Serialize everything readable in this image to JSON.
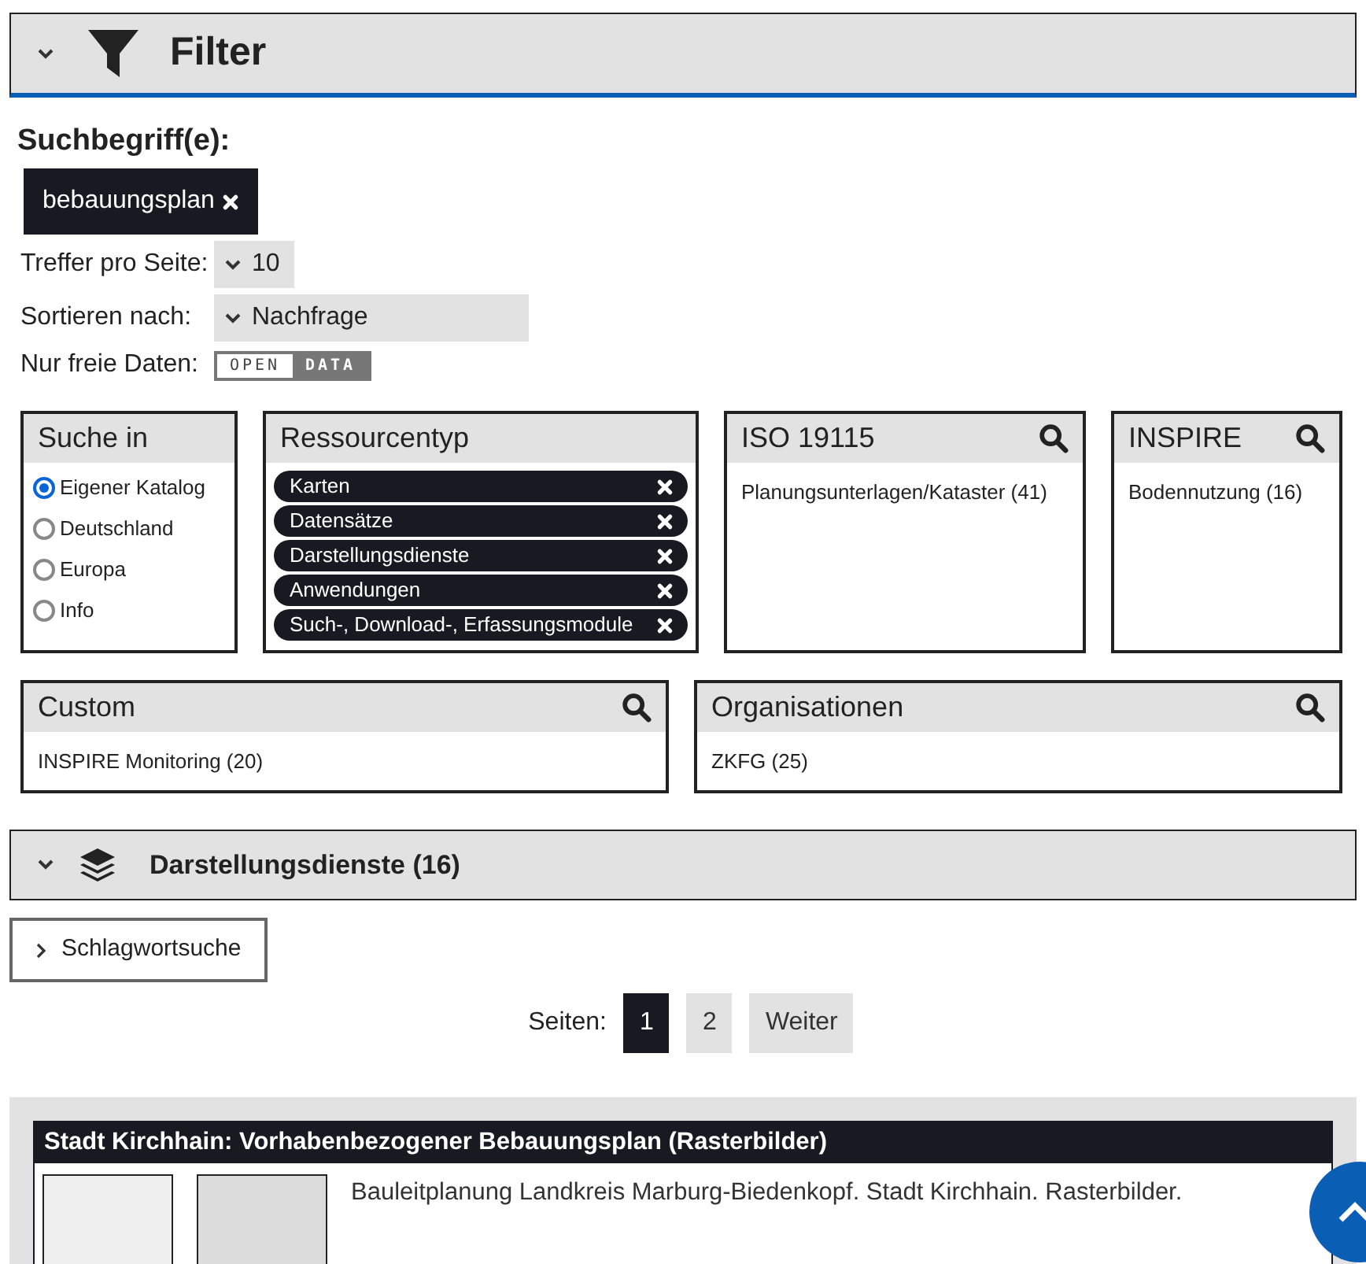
{
  "filter_section": {
    "title": "Filter",
    "expanded": true
  },
  "search_terms": {
    "label": "Suchbegriff(e):",
    "tags": [
      "bebauungsplan"
    ]
  },
  "hits_per_page": {
    "label": "Treffer pro Seite:",
    "value": "10"
  },
  "sort": {
    "label": "Sortieren nach:",
    "value": "Nachfrage"
  },
  "free_data": {
    "label": "Nur freie Daten:",
    "toggle_left": "OPEN",
    "toggle_right": "DATA",
    "on": false
  },
  "facets": [
    {
      "title": "Suche in",
      "kind": "radio",
      "searchable": false,
      "items": [
        {
          "label": "Eigener Katalog",
          "selected": true
        },
        {
          "label": "Deutschland",
          "selected": false
        },
        {
          "label": "Europa",
          "selected": false
        },
        {
          "label": "Info",
          "selected": false
        }
      ]
    },
    {
      "title": "Ressourcentyp",
      "kind": "chips",
      "searchable": false,
      "items": [
        {
          "label": "Karten"
        },
        {
          "label": "Datensätze"
        },
        {
          "label": "Darstellungsdienste"
        },
        {
          "label": "Anwendungen"
        },
        {
          "label": "Such-, Download-, Erfassungsmodule"
        }
      ]
    },
    {
      "title": "ISO 19115",
      "kind": "list",
      "searchable": true,
      "items": [
        {
          "label": "Planungsunterlagen/Kataster (41)"
        }
      ]
    },
    {
      "title": "INSPIRE",
      "kind": "list",
      "searchable": true,
      "items": [
        {
          "label": "Bodennutzung (16)"
        }
      ]
    },
    {
      "title": "Custom",
      "kind": "list",
      "searchable": true,
      "items": [
        {
          "label": "INSPIRE Monitoring (20)"
        }
      ]
    },
    {
      "title": "Organisationen",
      "kind": "list",
      "searchable": true,
      "items": [
        {
          "label": "ZKFG (25)"
        }
      ]
    }
  ],
  "results_section": {
    "title": "Darstellungsdienste (16)",
    "expanded": true
  },
  "keyword_search": {
    "label": "Schlagwortsuche",
    "expanded": false
  },
  "pagination": {
    "label": "Seiten:",
    "pages": [
      {
        "label": "1",
        "selected": true
      },
      {
        "label": "2",
        "selected": false
      }
    ],
    "next": "Weiter"
  },
  "results": [
    {
      "title": "Stadt Kirchhain: Vorhabenbezogener Bebauungsplan (Rasterbilder)",
      "description": "Bauleitplanung Landkreis Marburg-Biedenkopf. Stadt Kirchhain. Rasterbilder."
    }
  ]
}
